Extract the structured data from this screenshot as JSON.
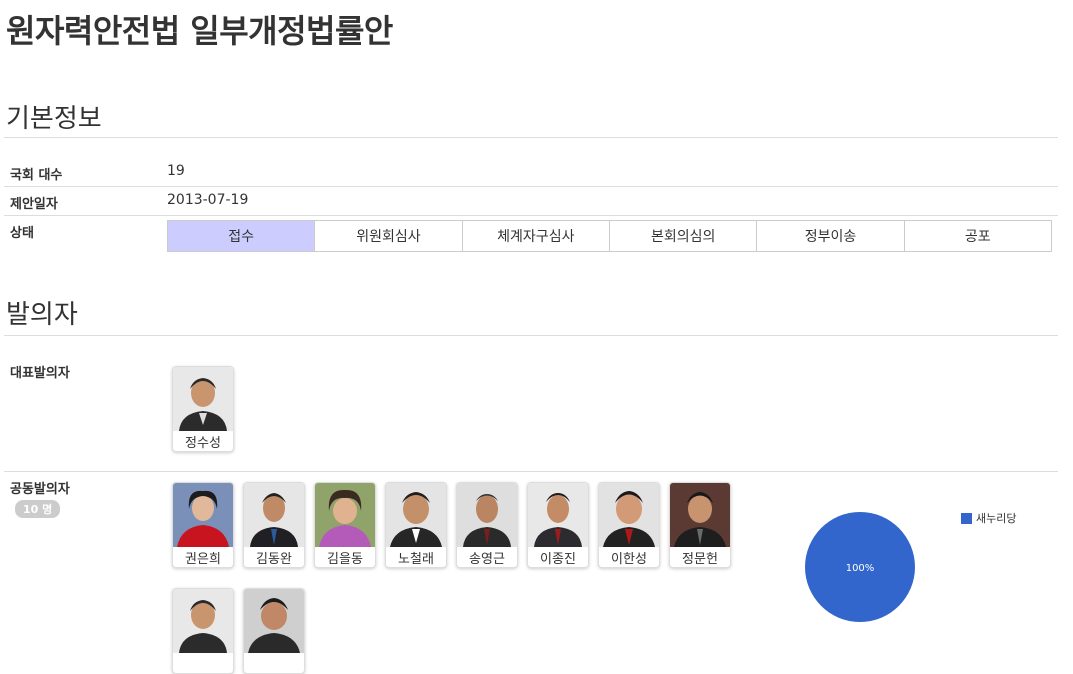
{
  "page_title": "원자력안전법 일부개정법률안",
  "basic": {
    "heading": "기본정보",
    "assembly_label": "국회 대수",
    "assembly_value": "19",
    "date_label": "제안일자",
    "date_value": "2013-07-19",
    "status_label": "상태",
    "status_steps": [
      "접수",
      "위원회심사",
      "체계자구심사",
      "본회의심의",
      "정부이송",
      "공포"
    ],
    "status_active": "접수"
  },
  "sponsors": {
    "heading": "발의자",
    "lead_label": "대표발의자",
    "lead": {
      "name": "정수성"
    },
    "co_label": "공동발의자",
    "co_count": "10 명",
    "co": [
      {
        "name": "권은희"
      },
      {
        "name": "김동완"
      },
      {
        "name": "김을동"
      },
      {
        "name": "노철래"
      },
      {
        "name": "송영근"
      },
      {
        "name": "이종진"
      },
      {
        "name": "이한성"
      },
      {
        "name": "정문헌"
      },
      {
        "name": ""
      },
      {
        "name": ""
      }
    ]
  },
  "chart_data": {
    "type": "pie",
    "slices": [
      {
        "label": "새누리당",
        "value": 100,
        "display": "100%",
        "color": "#3366cc"
      }
    ],
    "legend_position": "right"
  }
}
